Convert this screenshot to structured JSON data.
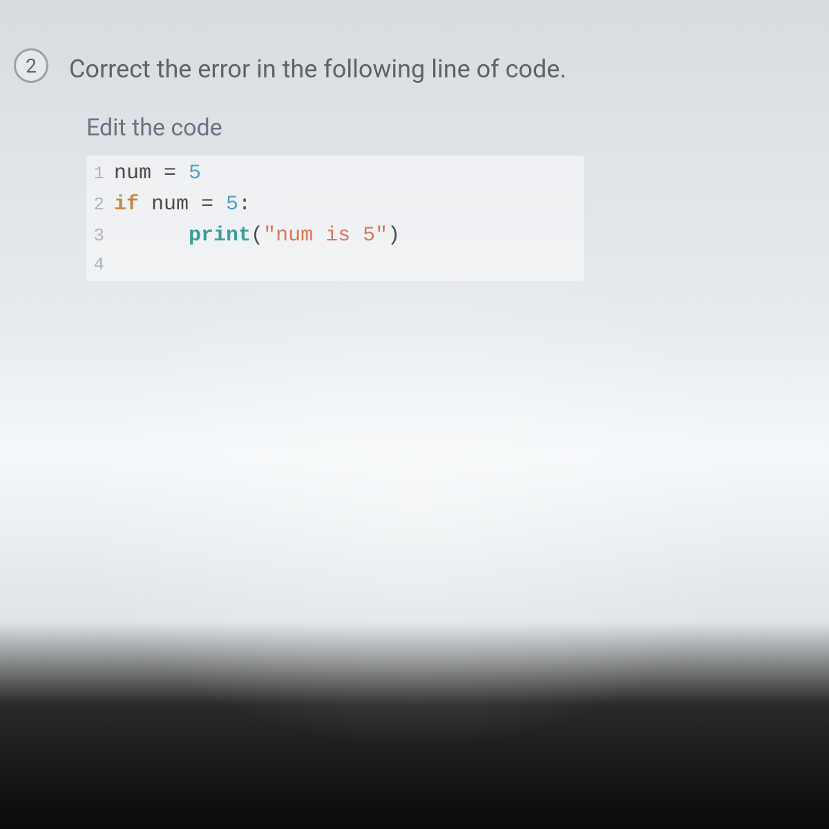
{
  "question": {
    "number": "2",
    "prompt": "Correct the error in the following line of code."
  },
  "editor": {
    "label": "Edit the code",
    "lines": [
      {
        "n": "1",
        "tokens": [
          {
            "t": "num ",
            "c": "tok-var"
          },
          {
            "t": "= ",
            "c": "tok-op"
          },
          {
            "t": "5",
            "c": "tok-num"
          }
        ]
      },
      {
        "n": "2",
        "tokens": [
          {
            "t": "if",
            "c": "tok-keyword"
          },
          {
            "t": " num ",
            "c": "tok-var"
          },
          {
            "t": "= ",
            "c": "tok-op"
          },
          {
            "t": "5",
            "c": "tok-num"
          },
          {
            "t": ":",
            "c": "tok-op"
          }
        ]
      },
      {
        "n": "3",
        "tokens": [
          {
            "t": "      ",
            "c": ""
          },
          {
            "t": "print",
            "c": "tok-func"
          },
          {
            "t": "(",
            "c": "tok-paren"
          },
          {
            "t": "\"num is 5\"",
            "c": "tok-string"
          },
          {
            "t": ")",
            "c": "tok-paren"
          }
        ]
      },
      {
        "n": "4",
        "tokens": []
      }
    ]
  }
}
